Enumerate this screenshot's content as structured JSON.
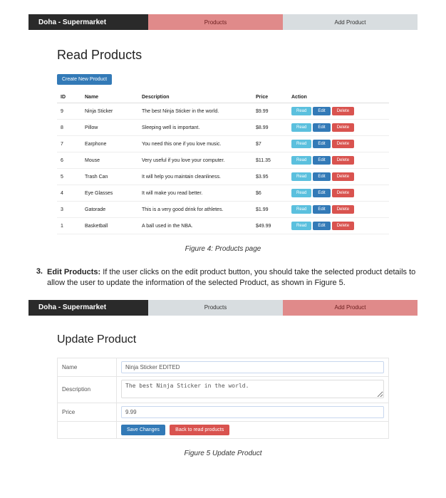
{
  "fig1": {
    "brand": "Doha - Supermarket",
    "tab_products": "Products",
    "tab_add": "Add Product",
    "title": "Read Products",
    "create_btn": "Create New Product",
    "headers": {
      "id": "ID",
      "name": "Name",
      "desc": "Description",
      "price": "Price",
      "action": "Action"
    },
    "action_labels": {
      "read": "Read",
      "edit": "Edit",
      "delete": "Delete",
      "delete_alt": "Delete"
    },
    "rows": [
      {
        "id": "9",
        "name": "Ninja Sticker",
        "desc": "The best Ninja Sticker in the world.",
        "price": "$9.99"
      },
      {
        "id": "8",
        "name": "Pillow",
        "desc": "Sleeping well is important.",
        "price": "$8.99"
      },
      {
        "id": "7",
        "name": "Earphone",
        "desc": "You need this one if you love music.",
        "price": "$7"
      },
      {
        "id": "6",
        "name": "Mouse",
        "desc": "Very useful if you love your computer.",
        "price": "$11.35"
      },
      {
        "id": "5",
        "name": "Trash Can",
        "desc": "It will help you maintain cleanliness.",
        "price": "$3.95"
      },
      {
        "id": "4",
        "name": "Eye Glasses",
        "desc": "It will make you read better.",
        "price": "$6"
      },
      {
        "id": "3",
        "name": "Gatorade",
        "desc": "This is a very good drink for athletes.",
        "price": "$1.99"
      },
      {
        "id": "1",
        "name": "Basketball",
        "desc": "A ball used in the NBA.",
        "price": "$49.99"
      }
    ],
    "caption": "Figure 4: Products page"
  },
  "step": {
    "num": "3.",
    "label": "Edit Products:",
    "text": " If the user clicks on the edit product button, you should take the selected product details to allow the user to update the information of the selected Product, as shown in Figure 5."
  },
  "fig2": {
    "brand": "Doha - Supermarket",
    "tab_products": "Products",
    "tab_add": "Add Product",
    "title": "Update Product",
    "labels": {
      "name": "Name",
      "desc": "Description",
      "price": "Price"
    },
    "values": {
      "name": "Ninja Sticker EDITED",
      "desc": "The best Ninja Sticker in the world.",
      "price": "9.99"
    },
    "buttons": {
      "save": "Save Changes",
      "back": "Back to read products"
    },
    "caption": "Figure 5 Update Product"
  }
}
